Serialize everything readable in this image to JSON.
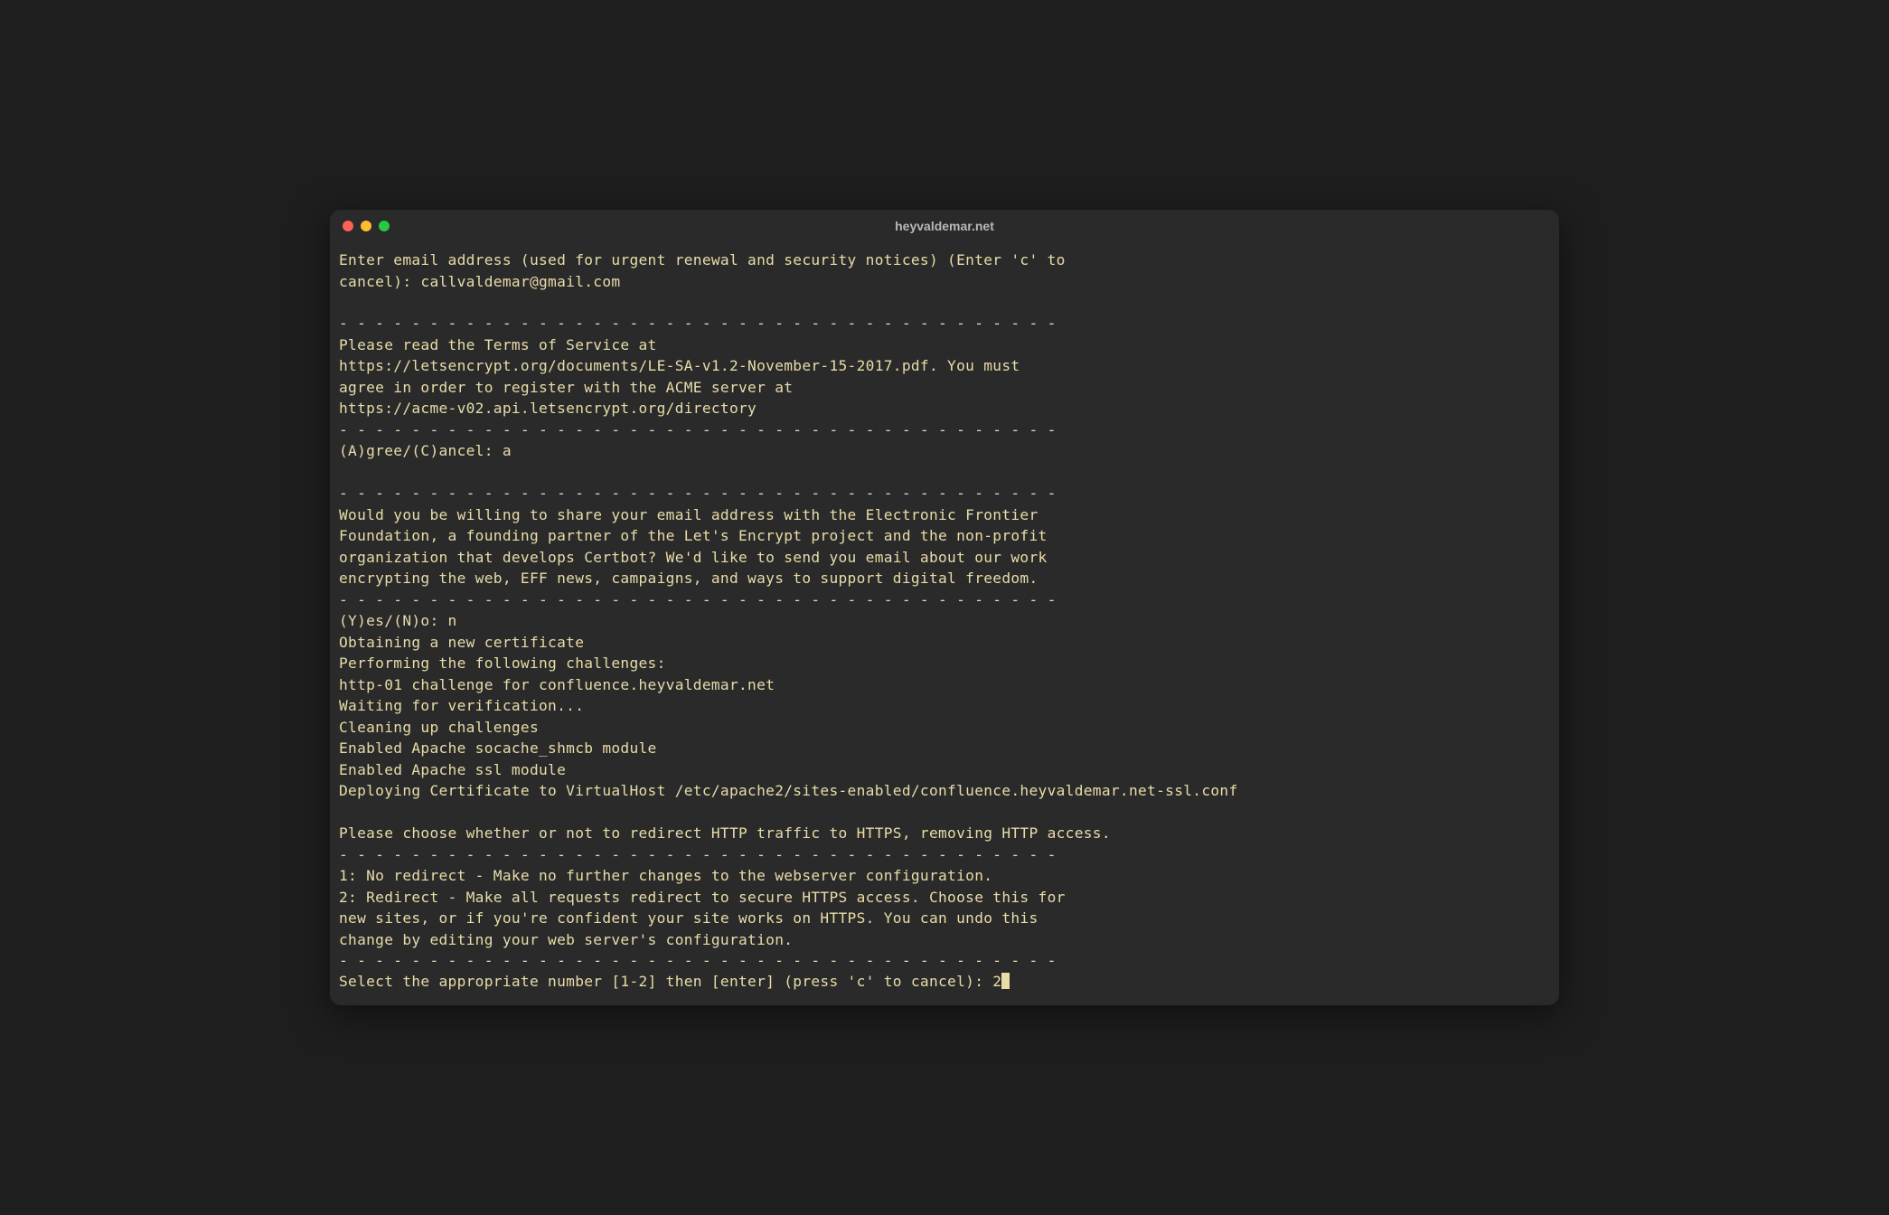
{
  "window": {
    "title": "heyvaldemar.net"
  },
  "terminal": {
    "lines": [
      "Enter email address (used for urgent renewal and security notices) (Enter 'c' to",
      "cancel): callvaldemar@gmail.com",
      "",
      "- - - - - - - - - - - - - - - - - - - - - - - - - - - - - - - - - - - - - - - -",
      "Please read the Terms of Service at",
      "https://letsencrypt.org/documents/LE-SA-v1.2-November-15-2017.pdf. You must",
      "agree in order to register with the ACME server at",
      "https://acme-v02.api.letsencrypt.org/directory",
      "- - - - - - - - - - - - - - - - - - - - - - - - - - - - - - - - - - - - - - - -",
      "(A)gree/(C)ancel: a",
      "",
      "- - - - - - - - - - - - - - - - - - - - - - - - - - - - - - - - - - - - - - - -",
      "Would you be willing to share your email address with the Electronic Frontier",
      "Foundation, a founding partner of the Let's Encrypt project and the non-profit",
      "organization that develops Certbot? We'd like to send you email about our work",
      "encrypting the web, EFF news, campaigns, and ways to support digital freedom.",
      "- - - - - - - - - - - - - - - - - - - - - - - - - - - - - - - - - - - - - - - -",
      "(Y)es/(N)o: n",
      "Obtaining a new certificate",
      "Performing the following challenges:",
      "http-01 challenge for confluence.heyvaldemar.net",
      "Waiting for verification...",
      "Cleaning up challenges",
      "Enabled Apache socache_shmcb module",
      "Enabled Apache ssl module",
      "Deploying Certificate to VirtualHost /etc/apache2/sites-enabled/confluence.heyvaldemar.net-ssl.conf",
      "",
      "Please choose whether or not to redirect HTTP traffic to HTTPS, removing HTTP access.",
      "- - - - - - - - - - - - - - - - - - - - - - - - - - - - - - - - - - - - - - - -",
      "1: No redirect - Make no further changes to the webserver configuration.",
      "2: Redirect - Make all requests redirect to secure HTTPS access. Choose this for",
      "new sites, or if you're confident your site works on HTTPS. You can undo this",
      "change by editing your web server's configuration.",
      "- - - - - - - - - - - - - - - - - - - - - - - - - - - - - - - - - - - - - - - -"
    ],
    "prompt": "Select the appropriate number [1-2] then [enter] (press 'c' to cancel): 2"
  }
}
